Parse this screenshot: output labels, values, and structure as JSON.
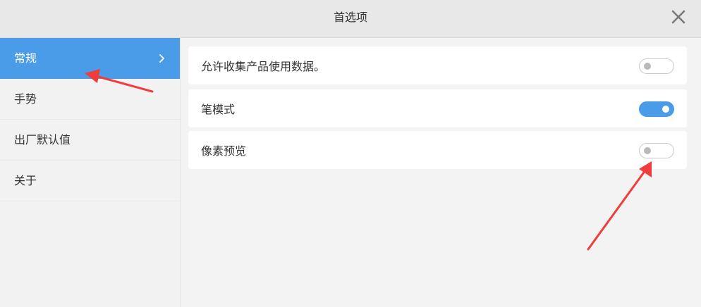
{
  "window": {
    "title": "首选项",
    "close_icon": "close-icon"
  },
  "sidebar": {
    "items": [
      {
        "label": "常规",
        "active": true,
        "icon": "chevron-right-icon"
      },
      {
        "label": "手势",
        "active": false
      },
      {
        "label": "出厂默认值",
        "active": false
      },
      {
        "label": "关于",
        "active": false
      }
    ]
  },
  "settings": {
    "rows": [
      {
        "label": "允许收集产品使用数据。",
        "enabled": false
      },
      {
        "label": "笔模式",
        "enabled": true
      },
      {
        "label": "像素预览",
        "enabled": false
      }
    ]
  },
  "colors": {
    "accent": "#4a9be8",
    "annotation_arrow": "#f03c3c"
  }
}
